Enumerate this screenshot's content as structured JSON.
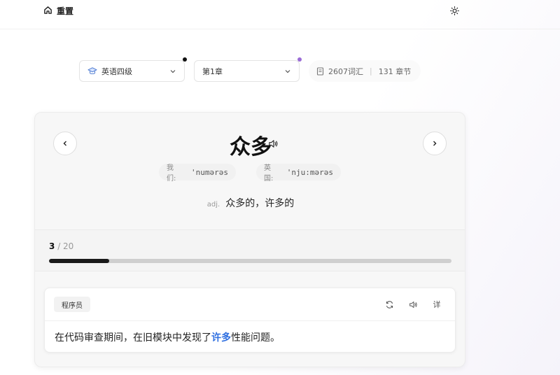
{
  "topbar": {
    "home_label": "重置"
  },
  "selectors": {
    "book": "英语四级",
    "chapter": "第1章"
  },
  "stats": {
    "words": "2607词汇",
    "chapters": "131 章节"
  },
  "word": {
    "text": "众多",
    "us_label": "我们:",
    "us_ipa": "'numərəs",
    "uk_label": "英国:",
    "uk_ipa": "'nju:mərəs",
    "pos": "adj.",
    "definition": "众多的，许多的"
  },
  "progress": {
    "current": "3",
    "total": "/ 20",
    "fraction": 0.15
  },
  "example": {
    "tag": "程序员",
    "detail_label": "详",
    "before": "在代码审查期间，在旧模块中发现了",
    "highlight": "许多",
    "after": "性能问题。"
  },
  "colors": {
    "highlight": "#2f6fe0",
    "progress": "#1a1a1a",
    "dot_purple": "#9b6cd6"
  }
}
